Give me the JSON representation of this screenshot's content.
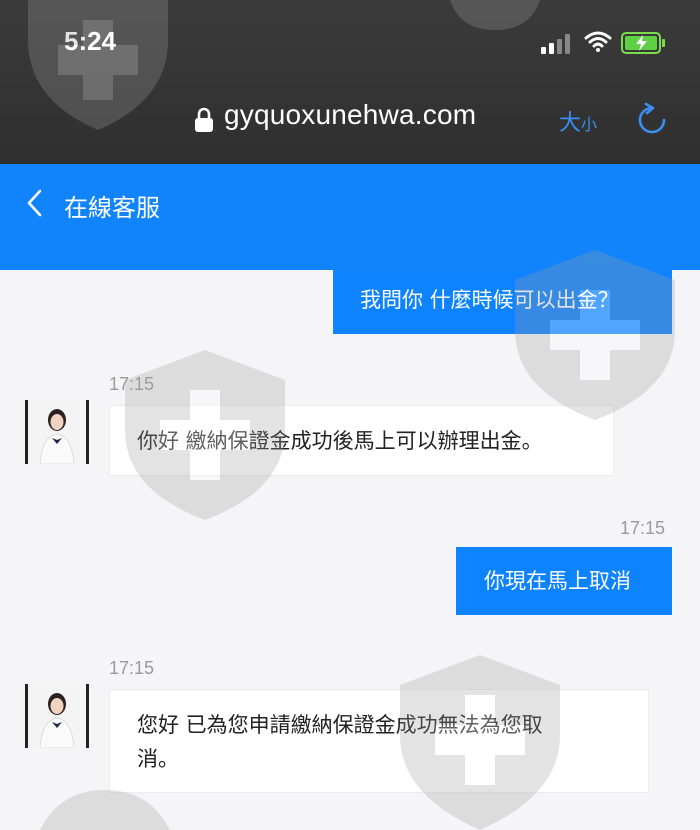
{
  "status_bar": {
    "time": "5:24"
  },
  "browser": {
    "url": "gyquoxunehwa.com",
    "text_size_big": "大",
    "text_size_small": "小"
  },
  "header": {
    "title": "在線客服"
  },
  "messages": [
    {
      "direction": "out",
      "text": "我問你 什麼時候可以出金？"
    },
    {
      "direction": "in",
      "time": "17:15",
      "text": "你好 繳納保證金成功後馬上可以辦理出金。"
    },
    {
      "direction": "out",
      "time": "17:15",
      "text": "你現在馬上取消"
    },
    {
      "direction": "in",
      "time": "17:15",
      "text_line1": "您好 已為您申請繳納保證金成功無法為您取",
      "text_line2": "消。"
    }
  ],
  "colors": {
    "accent": "#1184fb",
    "out_bubble": "#0e83ff",
    "topbar": "#333333"
  }
}
